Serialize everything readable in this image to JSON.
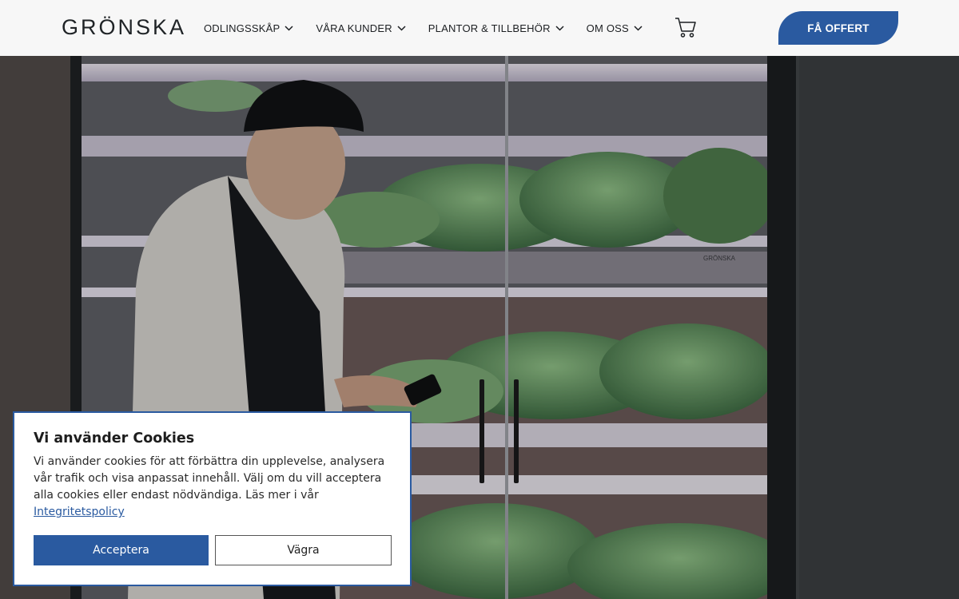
{
  "header": {
    "logo": "GRÖNSKA",
    "nav": [
      {
        "label": "ODLINGSSKÅP"
      },
      {
        "label": "VÅRA KUNDER"
      },
      {
        "label": "PLANTOR & TILLBEHÖR"
      },
      {
        "label": "OM OSS"
      }
    ],
    "cart_icon": "shopping-cart-icon",
    "quote_button": "FÅ OFFERT"
  },
  "hero": {
    "cabinet_brand": "GRÖNSKA"
  },
  "cookie_dialog": {
    "title": "Vi använder Cookies",
    "text": "Vi använder cookies för att förbättra din upplevelse, analysera vår trafik och visa anpassat innehåll. Välj om du vill acceptera alla cookies eller endast nödvändiga. Läs mer i vår ",
    "link_label": "Integritetspolicy",
    "accept_label": "Acceptera",
    "decline_label": "Vägra"
  },
  "colors": {
    "accent": "#2a5aa0",
    "header_bg": "#f7f7f7"
  }
}
